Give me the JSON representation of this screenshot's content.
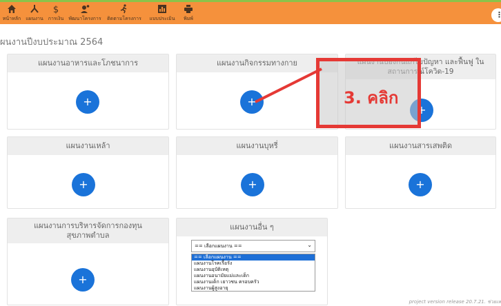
{
  "toolbar": {
    "items": [
      {
        "label": "หน้าหลัก",
        "icon": "home-icon"
      },
      {
        "label": "แผนงาน",
        "icon": "org-chart-icon"
      },
      {
        "label": "การเงิน",
        "icon": "dollar-icon"
      },
      {
        "label": "พัฒนาโครงการ",
        "icon": "person-lightbulb-icon"
      },
      {
        "label": "ติดตามโครงการ",
        "icon": "running-icon"
      },
      {
        "label": "แบบประเมิน",
        "icon": "bar-chart-icon"
      },
      {
        "label": "พิมพ์",
        "icon": "print-icon"
      }
    ],
    "more": "⋮"
  },
  "page_title": "ผนงานปีงบประมาณ 2564",
  "cards": [
    {
      "title": "แผนงานอาหารและโภชนาการ"
    },
    {
      "title": "แผนงานกิจกรรมทางกาย"
    },
    {
      "title": "แผนงานป้องกันแก้ไขปัญหา และฟื้นฟู ในสถานการณ์โควิด-19"
    },
    {
      "title": "แผนงานเหล้า"
    },
    {
      "title": "แผนงานบุหรี่"
    },
    {
      "title": "แผนงานสารเสพติด"
    },
    {
      "title": "แผนงานการบริหารจัดการกองทุนสุขภาพตำบล"
    },
    {
      "title": "แผนงานอื่น ๆ"
    }
  ],
  "plus_symbol": "+",
  "other_plan_select": {
    "value": "== เลือกแผนงาน ==",
    "options": [
      "== เลือกแผนงาน ==",
      "แผนงานโรคเรื้อรัง",
      "แผนงานอุบัติเหตุ",
      "แผนงานอนามัยแม่และเด็ก",
      "แผนงานเด็ก เยาวชน ครอบครัว",
      "แผนงานผู้สูงอายุ"
    ]
  },
  "annotation": {
    "text": "3. คลิก",
    "color": "#e53935"
  },
  "version_text": "project version release 20.7.21. ช่วยเห",
  "colors": {
    "toolbar": "#f5913c",
    "accent": "#1a73d9",
    "card_header": "#eeeeee"
  }
}
